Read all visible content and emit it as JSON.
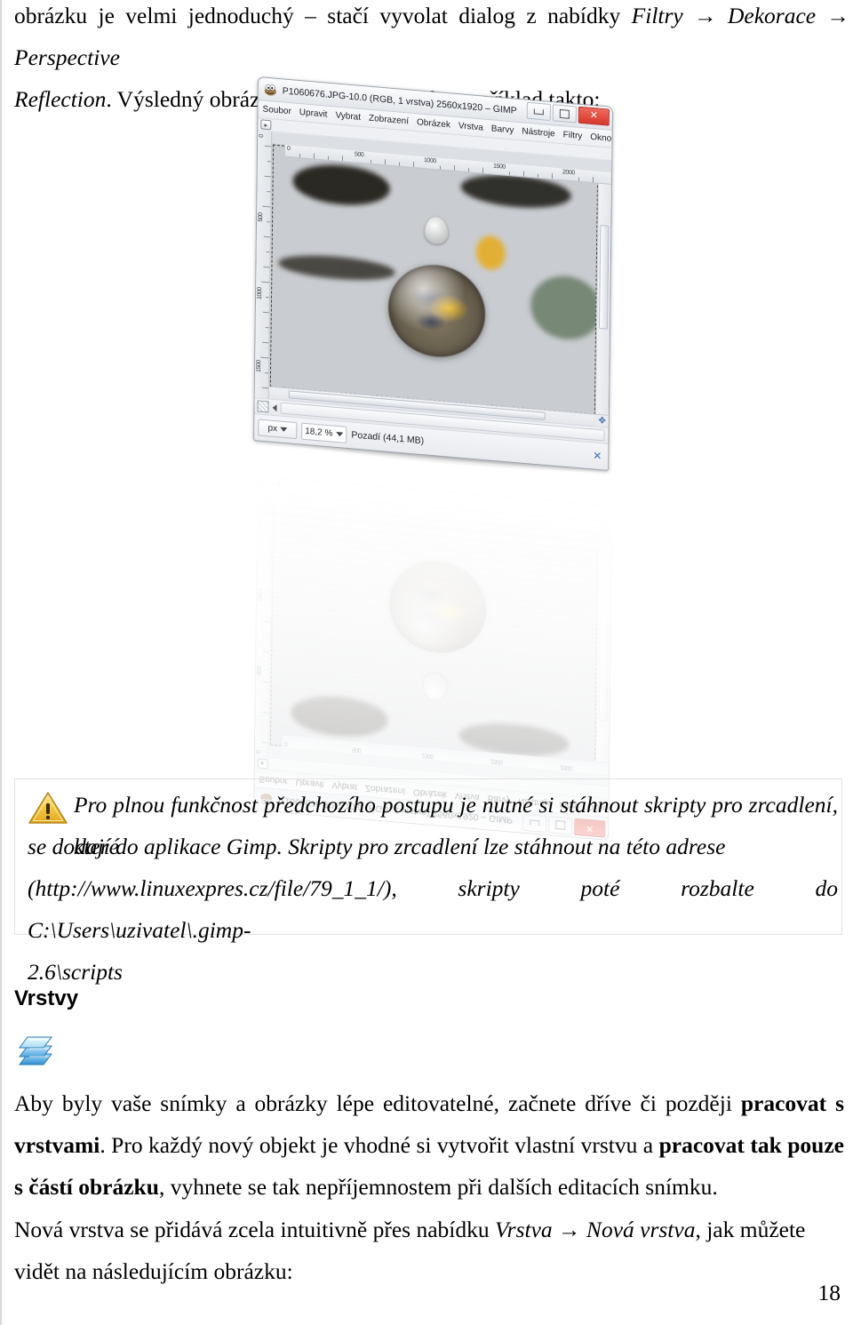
{
  "document": {
    "page_number": "18",
    "intro_paragraph": {
      "line1_pre": "obrázku je velmi jednoduchý – stačí vyvolat dialog z nabídky ",
      "line1_menu": "Filtry → Dekorace → Perspective",
      "line2_menu": "Reflection",
      "line2_post": ". Výsledný obrázek pak může vypadat například takto:"
    },
    "note": {
      "icon": "warning-triangle-icon",
      "line1": "Pro plnou funkčnost předchozího postupu je nutné si stáhnout skripty pro zrcadlení, které",
      "line2": "se dodají do aplikace Gimp. Skripty pro zrcadlení lze stáhnout na této adrese",
      "line3": "(http://www.linuxexpres.cz/file/79_1_1/), skripty poté rozbalte do C:\\Users\\uzivatel\\.gimp-",
      "line4": "2.6\\scripts"
    },
    "section": {
      "heading": "Vrstvy",
      "icon": "layers-stack-icon"
    },
    "paragraph_aby": {
      "part1": "Aby byly vaše snímky a obrázky lépe editovatelné, začnete dříve či později ",
      "bold1": "pracovat s vrstvami",
      "part2": ". Pro každý nový objekt je vhodné si vytvořit vlastní vrstvu a ",
      "bold2": "pracovat tak pouze s částí obrázku",
      "part3": ", vyhnete se tak nepříjemnostem při dalších editacích snímku."
    },
    "paragraph_nova": {
      "part1": "Nová vrstva se přidává zcela intuitivně přes nabídku ",
      "italic1": "Vrstva → Nová vrstva",
      "part2": ", jak můžete vidět na následujícím obrázku:"
    }
  },
  "figure": {
    "caption_semantic": "gimp-window-perspective-reflection",
    "gimp_window": {
      "title": "P1060676.JPG-10.0 (RGB, 1 vrstva) 2560x1920 – GIMP",
      "app_icon": "wilber-icon",
      "window_controls": {
        "minimize": "minimize-icon",
        "maximize": "maximize-icon",
        "close": "✕"
      },
      "menu": [
        "Soubor",
        "Upravit",
        "Vybrat",
        "Zobrazení",
        "Obrázek",
        "Vrstva",
        "Barvy",
        "Nástroje",
        "Filtry",
        "Okno"
      ],
      "horizontal_ruler_labels": [
        "0",
        "500",
        "1000",
        "1500",
        "2000"
      ],
      "vertical_ruler_labels": [
        "0",
        "500",
        "1000",
        "1500"
      ],
      "statusbar": {
        "unit": "px",
        "zoom": "18,2 %",
        "layer_info": "Pozadí (44,1 MB)"
      }
    }
  },
  "colors": {
    "warning_fill": "#f5c63c",
    "warning_stroke": "#b5871a",
    "layers_blue": "#4fa6e0",
    "layers_blue_light": "#bfe3f7",
    "close_button_red": "#d8372a",
    "page_background": "#ffffff",
    "text": "#000000"
  }
}
